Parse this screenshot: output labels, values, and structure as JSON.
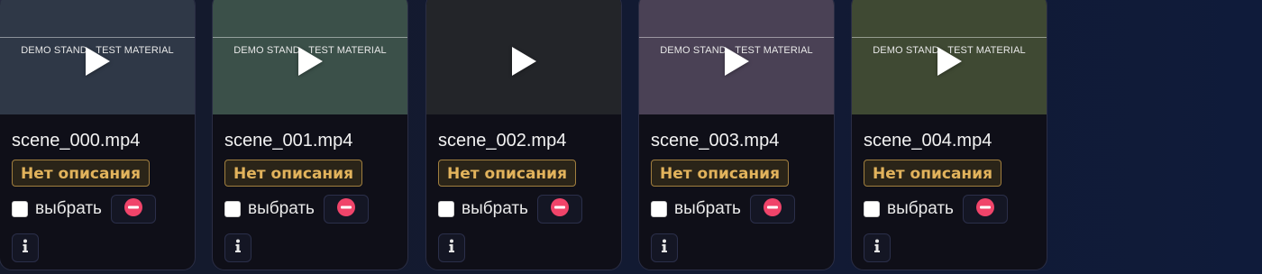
{
  "cards": [
    {
      "filename": "scene_000.mp4",
      "thumbnail_text": "DEMO STAND   TEST MATERIAL",
      "thumbnail_color": "#2f3847",
      "show_overlay": true,
      "badge": "Нет описания",
      "select_label": "выбрать"
    },
    {
      "filename": "scene_001.mp4",
      "thumbnail_text": "DEMO STAND   TEST MATERIAL",
      "thumbnail_color": "#3b5049",
      "show_overlay": true,
      "badge": "Нет описания",
      "select_label": "выбрать"
    },
    {
      "filename": "scene_002.mp4",
      "thumbnail_text": "",
      "thumbnail_color": "#232529",
      "show_overlay": false,
      "badge": "Нет описания",
      "select_label": "выбрать"
    },
    {
      "filename": "scene_003.mp4",
      "thumbnail_text": "DEMO STAND   TEST MATERIAL",
      "thumbnail_color": "#4a4155",
      "show_overlay": true,
      "badge": "Нет описания",
      "select_label": "выбрать"
    },
    {
      "filename": "scene_004.mp4",
      "thumbnail_text": "DEMO STAND   TEST MATERIAL",
      "thumbnail_color": "#3f4933",
      "show_overlay": true,
      "badge": "Нет описания",
      "select_label": "выбрать"
    }
  ],
  "icons": {
    "play": "play-icon",
    "remove": "remove-circle-icon",
    "info": "info-icon"
  },
  "colors": {
    "badge_text": "#e2b35c",
    "remove_red": "#f0446a"
  }
}
